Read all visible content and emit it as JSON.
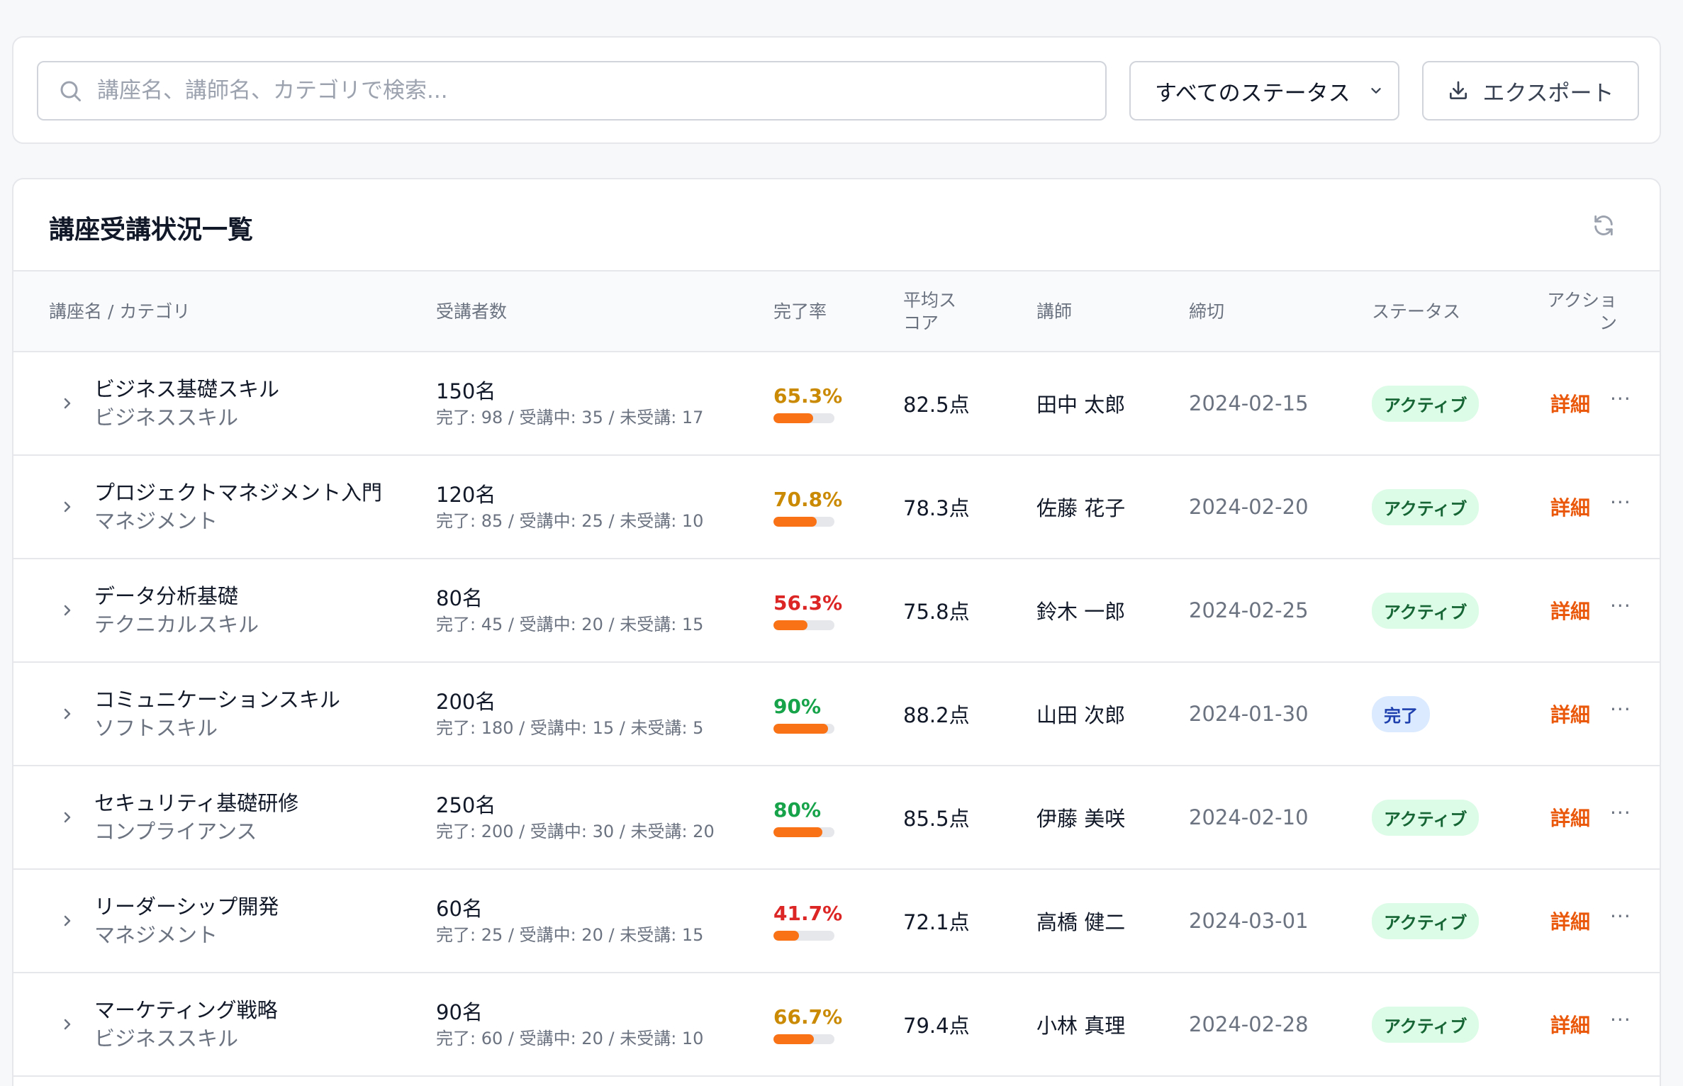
{
  "toolbar": {
    "search_placeholder": "講座名、講師名、カテゴリで検索...",
    "status_filter": "すべてのステータス",
    "export_label": "エクスポート"
  },
  "table": {
    "title": "講座受講状況一覧",
    "headers": {
      "name": "講座名 / カテゴリ",
      "count": "受講者数",
      "rate": "完了率",
      "score": "平均ス\nコア",
      "instructor": "講師",
      "deadline": "締切",
      "status": "ステータス",
      "action": "アクショ\nン"
    },
    "rows": [
      {
        "name": "ビジネス基礎スキル",
        "category": "ビジネススキル",
        "count": "150名",
        "breakdown": "完了: 98 / 受講中: 35 / 未受講: 17",
        "rate": "65.3%",
        "rate_value": 65.3,
        "rate_color": "#ca8a04",
        "score": "82.5点",
        "instructor": "田中 太郎",
        "deadline": "2024-02-15",
        "status": "アクティブ",
        "status_type": "active",
        "detail": "詳細",
        "more": "···"
      },
      {
        "name": "プロジェクトマネジメント入門",
        "category": "マネジメント",
        "count": "120名",
        "breakdown": "完了: 85 / 受講中: 25 / 未受講: 10",
        "rate": "70.8%",
        "rate_value": 70.8,
        "rate_color": "#ca8a04",
        "score": "78.3点",
        "instructor": "佐藤 花子",
        "deadline": "2024-02-20",
        "status": "アクティブ",
        "status_type": "active",
        "detail": "詳細",
        "more": "···"
      },
      {
        "name": "データ分析基礎",
        "category": "テクニカルスキル",
        "count": "80名",
        "breakdown": "完了: 45 / 受講中: 20 / 未受講: 15",
        "rate": "56.3%",
        "rate_value": 56.3,
        "rate_color": "#dc2626",
        "score": "75.8点",
        "instructor": "鈴木 一郎",
        "deadline": "2024-02-25",
        "status": "アクティブ",
        "status_type": "active",
        "detail": "詳細",
        "more": "···"
      },
      {
        "name": "コミュニケーションスキル",
        "category": "ソフトスキル",
        "count": "200名",
        "breakdown": "完了: 180 / 受講中: 15 / 未受講: 5",
        "rate": "90%",
        "rate_value": 90,
        "rate_color": "#16a34a",
        "score": "88.2点",
        "instructor": "山田 次郎",
        "deadline": "2024-01-30",
        "status": "完了",
        "status_type": "done",
        "detail": "詳細",
        "more": "···"
      },
      {
        "name": "セキュリティ基礎研修",
        "category": "コンプライアンス",
        "count": "250名",
        "breakdown": "完了: 200 / 受講中: 30 / 未受講: 20",
        "rate": "80%",
        "rate_value": 80,
        "rate_color": "#16a34a",
        "score": "85.5点",
        "instructor": "伊藤 美咲",
        "deadline": "2024-02-10",
        "status": "アクティブ",
        "status_type": "active",
        "detail": "詳細",
        "more": "···"
      },
      {
        "name": "リーダーシップ開発",
        "category": "マネジメント",
        "count": "60名",
        "breakdown": "完了: 25 / 受講中: 20 / 未受講: 15",
        "rate": "41.7%",
        "rate_value": 41.7,
        "rate_color": "#dc2626",
        "score": "72.1点",
        "instructor": "高橋 健二",
        "deadline": "2024-03-01",
        "status": "アクティブ",
        "status_type": "active",
        "detail": "詳細",
        "more": "···"
      },
      {
        "name": "マーケティング戦略",
        "category": "ビジネススキル",
        "count": "90名",
        "breakdown": "完了: 60 / 受講中: 20 / 未受講: 10",
        "rate": "66.7%",
        "rate_value": 66.7,
        "rate_color": "#ca8a04",
        "score": "79.4点",
        "instructor": "小林 真理",
        "deadline": "2024-02-28",
        "status": "アクティブ",
        "status_type": "active",
        "detail": "詳細",
        "more": "···"
      }
    ]
  }
}
